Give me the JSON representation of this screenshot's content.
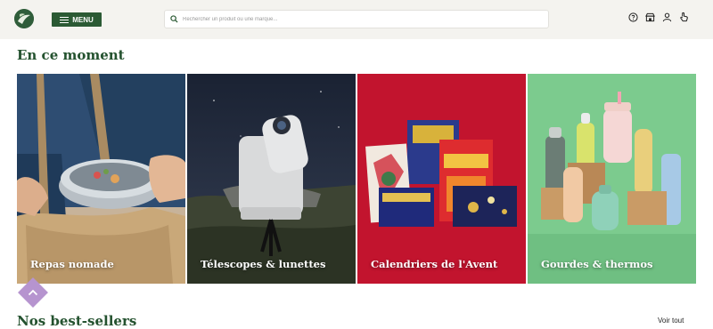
{
  "header": {
    "menu_label": "MENU",
    "search_placeholder": "Rechercher un produit ou une marque...",
    "icons": [
      "help-icon",
      "store-icon",
      "account-icon",
      "cart-icon"
    ]
  },
  "section": {
    "title": "En ce moment",
    "cards": [
      {
        "label": "Repas nomade"
      },
      {
        "label": "Télescopes & lunettes"
      },
      {
        "label": "Calendriers de l'Avent"
      },
      {
        "label": "Gourdes & thermos"
      }
    ]
  },
  "best_sellers": {
    "title": "Nos best-sellers",
    "see_all": "Voir tout"
  },
  "colors": {
    "brand_green": "#2b5a34",
    "scroll_top": "#b694cf"
  }
}
